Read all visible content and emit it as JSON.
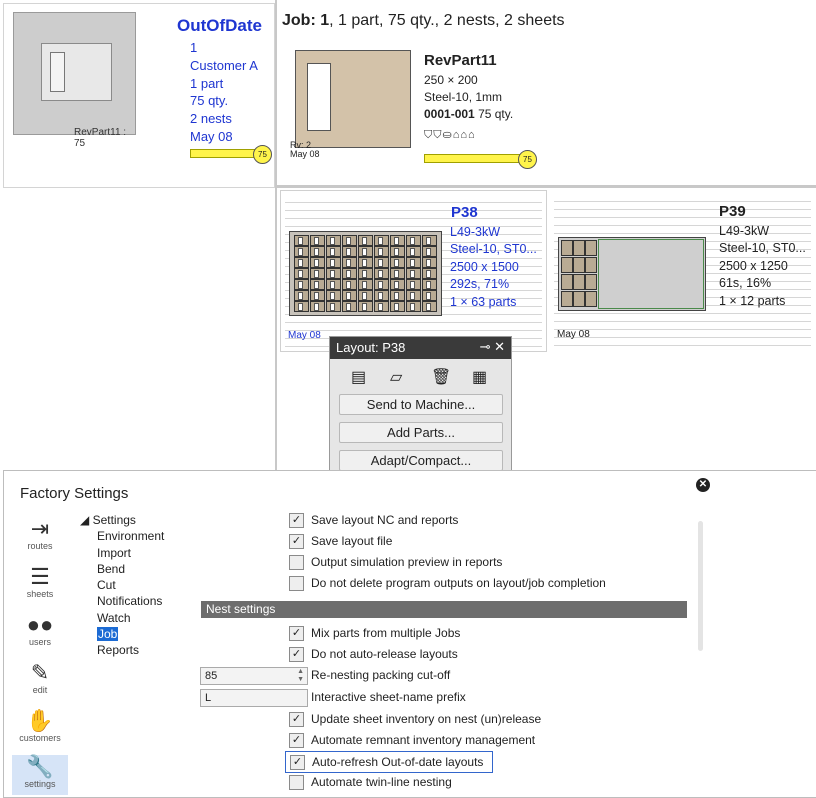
{
  "job_card": {
    "status": "OutOfDate",
    "lines": [
      "1",
      "Customer A",
      "1 part",
      "75 qty.",
      "2 nests",
      "May 08"
    ],
    "thumb_caption": "RevPart11 : 75",
    "progress": 1.0,
    "badge": "75"
  },
  "job_header": {
    "label": "Job:",
    "number": "1",
    "summary": ", 1 part, 75 qty., 2 nests, 2 sheets"
  },
  "part": {
    "name": "RevPart11",
    "size": "250 × 200",
    "material": "Steel-10, 1mm",
    "id": "0001-001",
    "qty": "75 qty.",
    "rev": "Rv: 2",
    "date": "May 08",
    "icons": "⛉⛉⛀⌂⌂⌂",
    "progress": 1.0,
    "badge": "75"
  },
  "nests": [
    {
      "name": "P38",
      "machine": "L49-3kW",
      "material": "Steel-10, ST0...",
      "sheet": "2500 x 1500",
      "stats": "292s, 71%",
      "parts": "1 × 63 parts",
      "date": "May 08",
      "color": "#1f36d1"
    },
    {
      "name": "P39",
      "machine": "L49-3kW",
      "material": "Steel-10, ST0...",
      "sheet": "2500 x 1250",
      "stats": "61s, 16%",
      "parts": "1 × 12 parts",
      "date": "May 08",
      "color": "#222222"
    }
  ],
  "layout_popup": {
    "title": "Layout: ",
    "name": "P38",
    "controls": "⊸ ✕",
    "tools": [
      "document-icon",
      "edit-document-icon",
      "trash-icon",
      "report-icon"
    ],
    "buttons": [
      "Send to Machine...",
      "Add Parts...",
      "Adapt/Compact..."
    ]
  },
  "factory_settings": {
    "title": "Factory Settings",
    "sidebar": [
      {
        "label": "routes",
        "icon": "signpost-icon"
      },
      {
        "label": "sheets",
        "icon": "sheets-icon"
      },
      {
        "label": "users",
        "icon": "users-icon"
      },
      {
        "label": "edit",
        "icon": "pencil-icon"
      },
      {
        "label": "customers",
        "icon": "handshake-icon"
      },
      {
        "label": "settings",
        "icon": "wrench-icon"
      }
    ],
    "tree_root": "◢ Settings",
    "tree": [
      "Environment",
      "Import",
      "Bend",
      "Cut",
      "Notifications",
      "Watch",
      "Job",
      "Reports"
    ],
    "tree_selected": "Job",
    "options_top": [
      {
        "label": "Save layout NC and reports",
        "checked": true
      },
      {
        "label": "Save layout file",
        "checked": true
      },
      {
        "label": "Output simulation preview in reports",
        "checked": false
      },
      {
        "label": "Do not delete program outputs on layout/job completion",
        "checked": false
      }
    ],
    "section_title": "Nest settings",
    "mix_parts": {
      "label": "Mix parts from multiple Jobs",
      "checked": true
    },
    "no_auto_release": {
      "label": "Do not auto-release layouts",
      "checked": true
    },
    "repacking": {
      "label": "Re-nesting packing cut-off",
      "value": "85"
    },
    "prefix": {
      "label": "Interactive sheet-name prefix",
      "value": "L"
    },
    "options_bottom": [
      {
        "label": "Update sheet inventory on nest (un)release",
        "checked": true
      },
      {
        "label": "Automate remnant inventory management",
        "checked": true
      },
      {
        "label": "Auto-refresh Out-of-date layouts",
        "checked": true
      },
      {
        "label": "Automate twin-line nesting",
        "checked": false
      }
    ]
  }
}
